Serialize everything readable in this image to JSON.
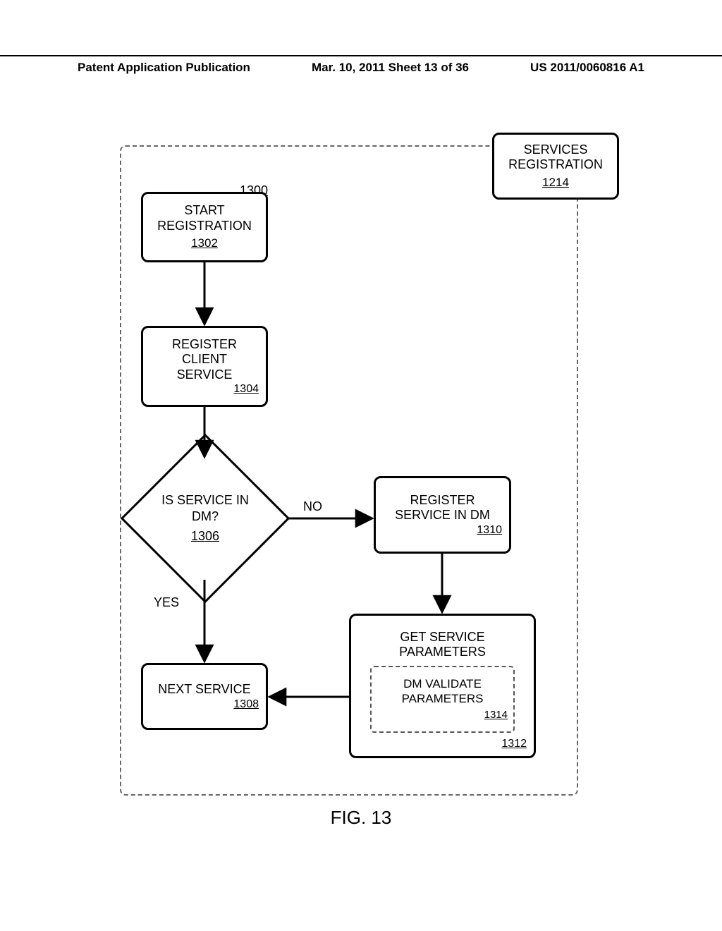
{
  "header": {
    "left": "Patent Application Publication",
    "center": "Mar. 10, 2011  Sheet 13 of 36",
    "right": "US 2011/0060816 A1"
  },
  "figure_label": "FIG. 13",
  "frame_ref": "1300",
  "nodes": {
    "services_registration": {
      "label": "SERVICES\nREGISTRATION",
      "ref": "1214"
    },
    "start_registration": {
      "label": "START\nREGISTRATION",
      "ref": "1302"
    },
    "register_client_service": {
      "label": "REGISTER\nCLIENT\nSERVICE",
      "ref": "1304"
    },
    "is_service_in_dm": {
      "label": "IS SERVICE IN\nDM?",
      "ref": "1306"
    },
    "next_service": {
      "label": "NEXT SERVICE",
      "ref": "1308"
    },
    "register_service_in_dm": {
      "label": "REGISTER\nSERVICE IN DM",
      "ref": "1310"
    },
    "get_service_parameters": {
      "label": "GET SERVICE\nPARAMETERS",
      "ref": "1312"
    },
    "dm_validate_parameters": {
      "label": "DM VALIDATE\nPARAMETERS",
      "ref": "1314"
    }
  },
  "edges": {
    "no": "NO",
    "yes": "YES"
  },
  "chart_data": {
    "type": "flowchart",
    "title": "Services Registration subprocess",
    "figure": "FIG. 13",
    "subprocess_of": {
      "id": "1214",
      "label": "SERVICES REGISTRATION"
    },
    "container_ref": "1300",
    "nodes": [
      {
        "id": "1302",
        "label": "START REGISTRATION",
        "shape": "process"
      },
      {
        "id": "1304",
        "label": "REGISTER CLIENT SERVICE",
        "shape": "process"
      },
      {
        "id": "1306",
        "label": "IS SERVICE IN DM?",
        "shape": "decision"
      },
      {
        "id": "1308",
        "label": "NEXT SERVICE",
        "shape": "process"
      },
      {
        "id": "1310",
        "label": "REGISTER SERVICE IN DM",
        "shape": "process"
      },
      {
        "id": "1312",
        "label": "GET SERVICE PARAMETERS",
        "shape": "process"
      },
      {
        "id": "1314",
        "label": "DM VALIDATE PARAMETERS",
        "shape": "subprocess",
        "parent": "1312"
      }
    ],
    "edges": [
      {
        "from": "1302",
        "to": "1304"
      },
      {
        "from": "1304",
        "to": "1306"
      },
      {
        "from": "1306",
        "to": "1308",
        "label": "YES"
      },
      {
        "from": "1306",
        "to": "1310",
        "label": "NO"
      },
      {
        "from": "1310",
        "to": "1312"
      },
      {
        "from": "1312",
        "to": "1308"
      }
    ]
  }
}
